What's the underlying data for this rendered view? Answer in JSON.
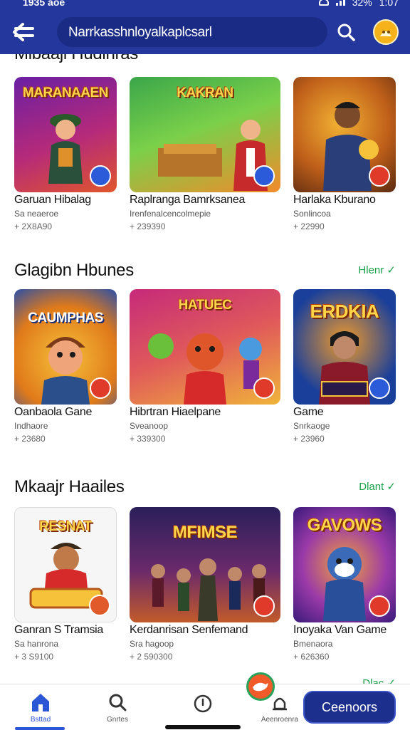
{
  "status_bar": {
    "time": "1935 aoe",
    "battery": "32%",
    "clock": "1:07"
  },
  "header": {
    "search_value": "Narrkasshnloyalkaplcsarl"
  },
  "sections": [
    {
      "title": "Mibaaji Hudinras",
      "cards": [
        {
          "thumb_title": "MARANAAEN",
          "name": "Garuan Hibalag",
          "sub": "Sa neaeroe",
          "price": "+ 2X8A90",
          "bg": [
            "#6a1fa3",
            "#e0562b"
          ],
          "badge": "#2b5bd8"
        },
        {
          "thumb_title": "KAKRAN",
          "name": "Raplranga Bamrksanea",
          "sub": "Irenfenalcencolmepie",
          "price": "+ 239390",
          "bg": [
            "#3aa64a",
            "#f28a2a"
          ],
          "badge": "#2b5bd8"
        },
        {
          "thumb_title": "",
          "name": "Harlaka Kburano",
          "sub": "Sonlincoa",
          "price": "+ 22990",
          "bg": [
            "#7a3c12",
            "#f2b233"
          ],
          "badge": "#e03a2a"
        }
      ]
    },
    {
      "title": "Glagibn Hbunes",
      "link": "Hlenr ✓",
      "cards": [
        {
          "thumb_title": "CAUMPHAS",
          "name": "Oanbaola Gane",
          "sub": "Indhaore",
          "price": "+ 23680",
          "bg": [
            "#f29a2a",
            "#2a4fa8"
          ],
          "badge": "#e03a2a"
        },
        {
          "thumb_title": "HATUEC",
          "name": "Hibrtran Hiaelpane",
          "sub": "Sveanoop",
          "price": "+ 339300",
          "bg": [
            "#c52a7a",
            "#f0b43a"
          ],
          "badge": "#e03a2a"
        },
        {
          "thumb_title": "ERDKIA",
          "name": "Game",
          "sub": "Snrkaoge",
          "price": "+ 23960",
          "bg": [
            "#1a3f9a",
            "#f09a2a"
          ],
          "badge": "#2b5bd8"
        }
      ]
    },
    {
      "title": "Mkaajr Haailes",
      "link": "Dlant ✓",
      "cards": [
        {
          "thumb_title": "RESNAT",
          "name": "Ganran S Tramsia",
          "sub": "Sa hanrona",
          "price": "+ 3 S9100",
          "bg": [
            "#f4f4f4",
            "#f6c23a"
          ],
          "badge": "#e05a2a"
        },
        {
          "thumb_title": "MFIMSE",
          "name": "Kerdanrisan Senfemand",
          "sub": "Sra hagoop",
          "price": "+ 2 590300",
          "bg": [
            "#2a1f5a",
            "#c25a2a"
          ],
          "badge": "#e03a2a"
        },
        {
          "thumb_title": "GAVOWS",
          "name": "Inoyaka Van Game",
          "sub": "Bmenaora",
          "price": "+ 626360",
          "bg": [
            "#4a2a9a",
            "#f2a23a"
          ],
          "badge": "#e03a2a"
        }
      ]
    },
    {
      "title": "",
      "link": "Dlac ✓",
      "cards": []
    }
  ],
  "bottom_nav": {
    "items": [
      {
        "label": "Bsttad",
        "icon": "home-icon"
      },
      {
        "label": "Gnrtes",
        "icon": "search-icon"
      },
      {
        "label": "",
        "icon": "compass-icon"
      },
      {
        "label": "Aeenroenra",
        "icon": "bell-icon"
      }
    ],
    "cta_label": "Ceenoors"
  },
  "colors": {
    "header": "#23379c",
    "accent_green": "#1aa14a",
    "cta": "#1c2f8c"
  }
}
